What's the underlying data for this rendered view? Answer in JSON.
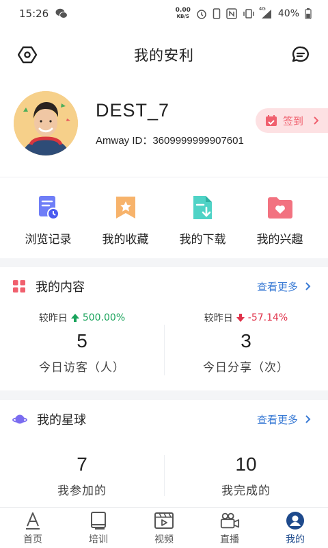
{
  "status_bar": {
    "time": "15:26",
    "net_speed_value": "0.00",
    "net_speed_unit": "KB/S",
    "network": "4G",
    "battery": "40%"
  },
  "header": {
    "title": "我的安利"
  },
  "profile": {
    "username": "DEST_7",
    "amway_id_label": "Amway ID：",
    "amway_id": "3609999999907601",
    "checkin_label": "签到"
  },
  "shortcuts": [
    {
      "label": "浏览记录",
      "icon": "history-icon",
      "color": "#5b6ef5"
    },
    {
      "label": "我的收藏",
      "icon": "bookmark-star-icon",
      "color": "#f5a354"
    },
    {
      "label": "我的下载",
      "icon": "file-download-icon",
      "color": "#3ecfc0"
    },
    {
      "label": "我的兴趣",
      "icon": "heart-folder-icon",
      "color": "#f0606e"
    }
  ],
  "content_card": {
    "title": "我的内容",
    "more_label": "查看更多",
    "stats": [
      {
        "compare_label": "较昨日",
        "trend": "up",
        "change": "500.00%",
        "value": "5",
        "label": "今日访客（人）"
      },
      {
        "compare_label": "较昨日",
        "trend": "down",
        "change": "-57.14%",
        "value": "3",
        "label": "今日分享（次）"
      }
    ]
  },
  "planet_card": {
    "title": "我的星球",
    "more_label": "查看更多",
    "stats": [
      {
        "value": "7",
        "label": "我参加的"
      },
      {
        "value": "10",
        "label": "我完成的"
      }
    ]
  },
  "tabbar": {
    "active": "我的",
    "tabs": [
      {
        "label": "首页",
        "icon": "home-a-icon"
      },
      {
        "label": "培训",
        "icon": "book-icon"
      },
      {
        "label": "视频",
        "icon": "video-icon"
      },
      {
        "label": "直播",
        "icon": "live-camera-icon"
      },
      {
        "label": "我的",
        "icon": "profile-icon"
      }
    ]
  },
  "colors": {
    "accent_blue": "#3a7bd5",
    "active_tab": "#1e4a8c",
    "checkin_bg": "#fde1e3",
    "checkin_text": "#f0606e",
    "up_green": "#19a35b",
    "down_red": "#e0324a"
  }
}
